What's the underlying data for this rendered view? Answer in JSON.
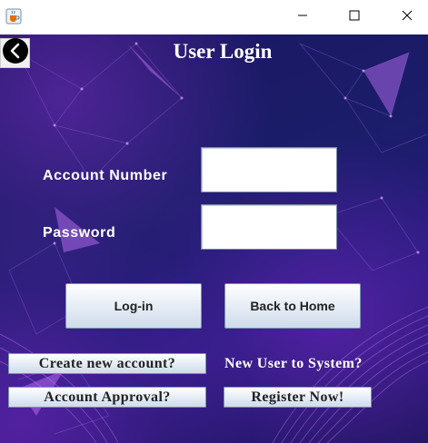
{
  "window": {
    "app_icon": "java-coffee-cup-icon",
    "minimize_icon": "minimize-icon",
    "maximize_icon": "maximize-icon",
    "close_icon": "close-icon"
  },
  "header": {
    "back_icon": "chevron-left-icon",
    "title": "User Login"
  },
  "form": {
    "account_label": "Account Number",
    "account_value": "",
    "password_label": "Password",
    "password_value": ""
  },
  "actions": {
    "login_label": "Log-in",
    "home_label": "Back to Home"
  },
  "footer": {
    "create_label": "Create new account?",
    "new_user_text": "New User to System?",
    "approval_label": "Account Approval?",
    "register_label": "Register Now!"
  },
  "colors": {
    "background_dark": "#1a1660",
    "accent_purple": "#8a2be2",
    "text_light": "#ffffff"
  }
}
